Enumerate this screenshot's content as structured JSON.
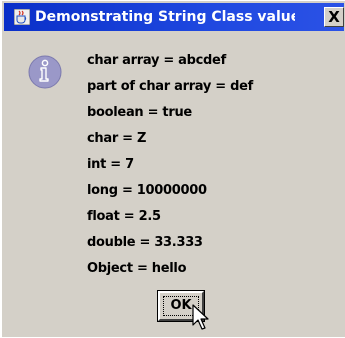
{
  "dialog": {
    "title": "Demonstrating String Class valueOf ...",
    "close_label": "X",
    "icon": "information-icon",
    "lines": [
      "char array = abcdef",
      "part of char array = def",
      "boolean = true",
      "char = Z",
      "int = 7",
      "long = 10000000",
      "float = 2.5",
      "double = 33.333",
      "Object = hello"
    ],
    "ok_label": "OK"
  },
  "colors": {
    "titlebar": "#1a3fd4",
    "dialog_bg": "#d4d0c8",
    "icon_fill": "#9a98c8"
  }
}
